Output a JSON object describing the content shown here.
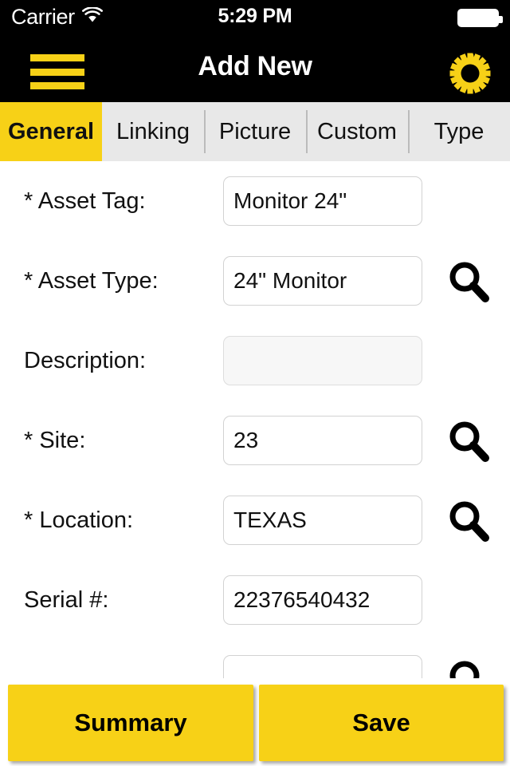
{
  "status_bar": {
    "carrier": "Carrier",
    "wifi_icon": "wifi-icon",
    "time": "5:29 PM",
    "battery_icon": "battery-full-icon"
  },
  "nav_bar": {
    "menu_icon": "hamburger-menu-icon",
    "title": "Add New",
    "settings_icon": "gear-icon",
    "background_color": "#000000",
    "accent_color": "#F7D117"
  },
  "tabs": [
    {
      "label": "General",
      "active": true
    },
    {
      "label": "Linking",
      "active": false
    },
    {
      "label": "Picture",
      "active": false
    },
    {
      "label": "Custom",
      "active": false
    },
    {
      "label": "Type",
      "active": false
    }
  ],
  "form": {
    "fields": [
      {
        "label": "* Asset Tag:",
        "value": "Monitor 24\"",
        "placeholder": "",
        "has_search": false,
        "disabled": false
      },
      {
        "label": "* Asset Type:",
        "value": "24\" Monitor",
        "placeholder": "",
        "has_search": true,
        "disabled": false
      },
      {
        "label": "Description:",
        "value": "",
        "placeholder": "",
        "has_search": false,
        "disabled": true
      },
      {
        "label": "* Site:",
        "value": "23",
        "placeholder": "",
        "has_search": true,
        "disabled": false
      },
      {
        "label": "* Location:",
        "value": "TEXAS",
        "placeholder": "",
        "has_search": true,
        "disabled": false
      },
      {
        "label": "Serial #:",
        "value": "22376540432",
        "placeholder": "",
        "has_search": false,
        "disabled": false
      },
      {
        "label": "",
        "value": "",
        "placeholder": "",
        "has_search": true,
        "disabled": false
      }
    ],
    "search_icon": "search-icon"
  },
  "footer": {
    "summary_label": "Summary",
    "save_label": "Save",
    "button_color": "#F7D117"
  }
}
